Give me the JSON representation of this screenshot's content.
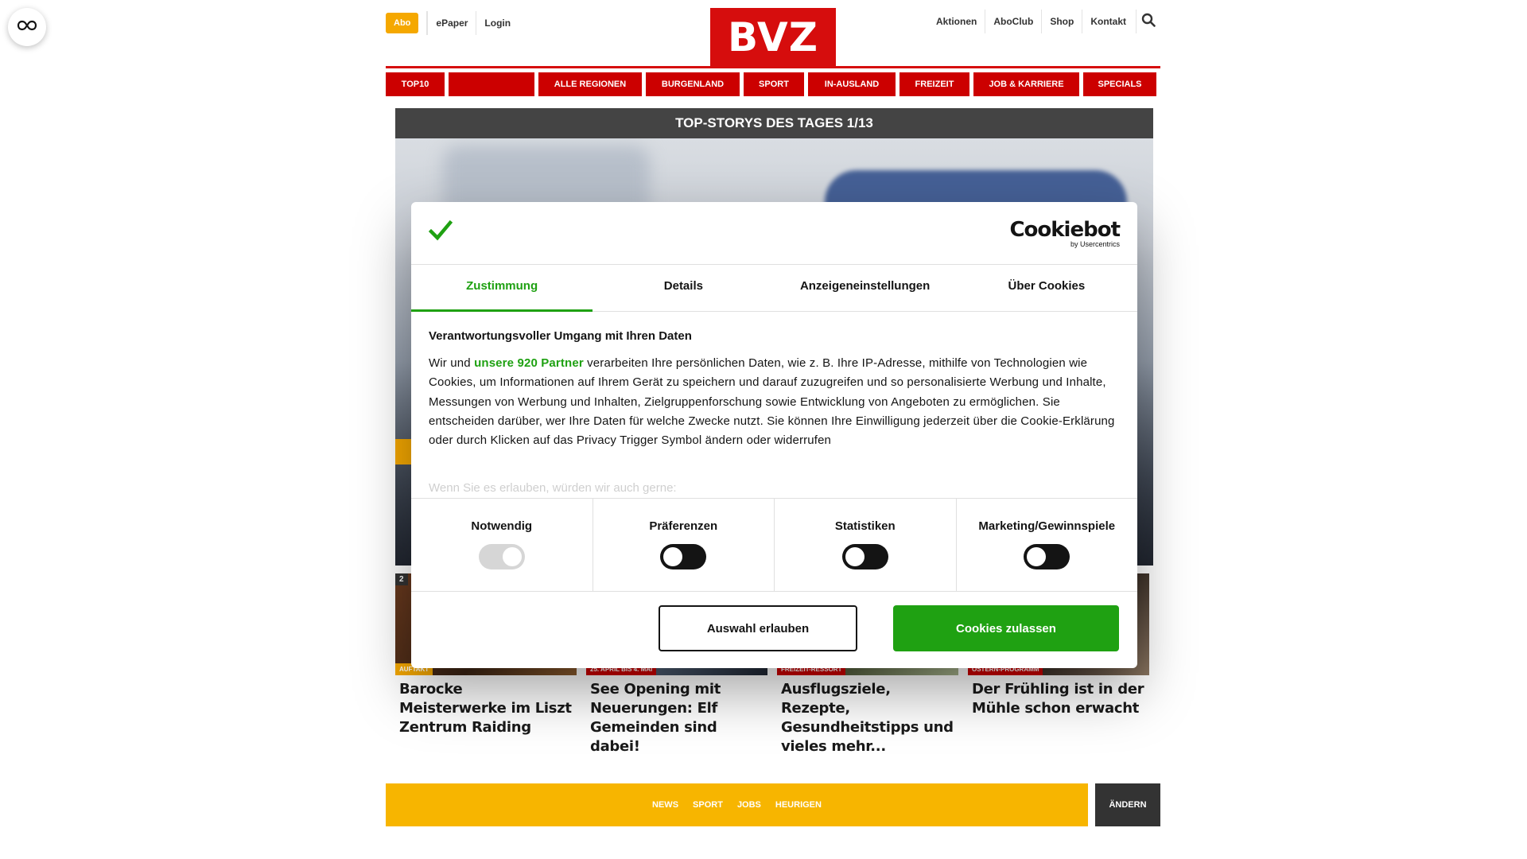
{
  "header": {
    "abo_label": "Abo",
    "epaper_label": "ePaper",
    "login_label": "Login",
    "logo_text": "BVZ",
    "right_links": [
      "Aktionen",
      "AboClub",
      "Shop",
      "Kontakt"
    ]
  },
  "nav": {
    "items": [
      "TOP10",
      "",
      "ALLE REGIONEN",
      "BURGENLAND",
      "SPORT",
      "IN-AUSLAND",
      "FREIZEIT",
      "JOB & KARRIERE",
      "SPECIALS"
    ]
  },
  "hero": {
    "title": "TOP-STORYS DES TAGES 1/13"
  },
  "teasers": [
    {
      "num": "2",
      "category": "AUFTAKT",
      "title": "Barocke Meisterwerke im Liszt Zentrum Raiding"
    },
    {
      "num": "",
      "category": "25. APRIL BIS 4. MAI",
      "title": "See Opening mit Neuerungen: Elf Gemeinden sind dabei!"
    },
    {
      "num": "",
      "category": "FREIZEIT-RESSORT",
      "title": "Ausflugsziele, Rezepte, Gesundheitstipps und vieles mehr..."
    },
    {
      "num": "",
      "category": "OSTERN-PROGRAMM",
      "title": "Der Frühling ist in der Mühle schon erwacht"
    }
  ],
  "region_bar": {
    "links": [
      "NEWS",
      "SPORT",
      "JOBS",
      "HEURIGEN"
    ],
    "change_label": "ÄNDERN"
  },
  "cookie": {
    "brand": "Cookiebot",
    "brand_sub": "by Usercentrics",
    "tabs": [
      "Zustimmung",
      "Details",
      "Anzeigeneinstellungen",
      "Über Cookies"
    ],
    "active_tab": "Zustimmung",
    "heading": "Verantwortungsvoller Umgang mit Ihren Daten",
    "text_pre": "Wir und ",
    "partner_link": "unsere 920 Partner",
    "text_post": " verarbeiten Ihre persönlichen Daten, wie z. B. Ihre IP-Adresse, mithilfe von Technologien wie Cookies, um Informationen auf Ihrem Gerät zu speichern und darauf zuzugreifen und so personalisierte Werbung und Inhalte, Messungen von Werbung und Inhalten, Zielgruppenforschung sowie Entwicklung von Angeboten zu ermöglichen. Sie entscheiden darüber, wer Ihre Daten für welche Zwecke nutzt. Sie können Ihre Einwilligung jederzeit über die Cookie-Erklärung oder durch Klicken auf das Privacy Trigger Symbol ändern oder widerrufen",
    "faded_text": "Wenn Sie es erlauben, würden wir auch gerne:",
    "toggles": [
      {
        "label": "Notwendig",
        "on": true,
        "disabled": true
      },
      {
        "label": "Präferenzen",
        "on": false,
        "disabled": false
      },
      {
        "label": "Statistiken",
        "on": false,
        "disabled": false
      },
      {
        "label": "Marketing/Gewinnspiele",
        "on": false,
        "disabled": false
      }
    ],
    "btn_allow_selection": "Auswahl erlauben",
    "btn_allow_all": "Cookies zulassen"
  },
  "colors": {
    "brand_red": "#d60d0d",
    "nav_red": "#cc0000",
    "abo_orange": "#f5a800",
    "cookie_green": "#1fa112",
    "region_yellow": "#f7b500"
  }
}
